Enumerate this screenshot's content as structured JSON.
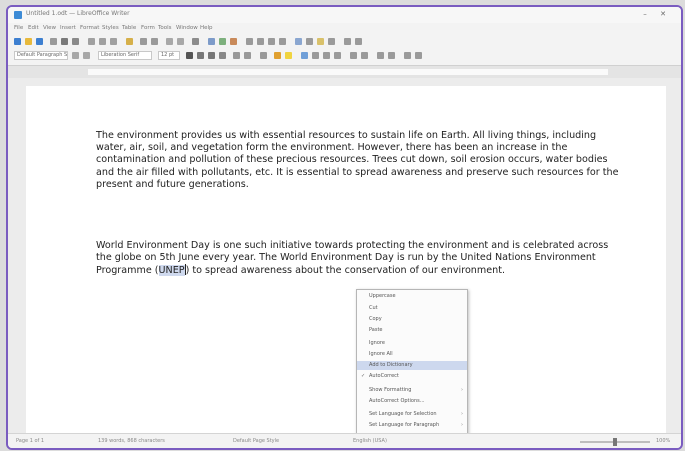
{
  "window": {
    "title": "Untitled 1.odt — LibreOffice Writer"
  },
  "menu": [
    "File",
    "Edit",
    "View",
    "Insert",
    "Format",
    "Styles",
    "Table",
    "Form",
    "Tools",
    "Window",
    "Help"
  ],
  "toolbar": {
    "paragraph_style": "Default Paragraph Style",
    "font_name": "Liberation Serif",
    "font_size": "12 pt"
  },
  "document": {
    "p1": "The environment provides us with essential resources to sustain life on Earth. All living things, including water, air, soil, and vegetation form the environment. However, there has been an increase in the contamination and pollution of these precious resources. Trees cut down, soil erosion occurs, water bodies and the air filled with pollutants, etc. It is essential to spread awareness and preserve such resources for the present and future generations.",
    "p2_before": "World Environment Day is one such initiative towards protecting the environment and is celebrated across the globe on 5th June every year. The World Environment Day is run by the United Nations Environment Programme (",
    "p2_selected": "UNEP",
    "p2_after": ") to spread awareness about the conservation of our environment."
  },
  "context_menu": {
    "items": [
      {
        "label": "Uppercase",
        "arrow": "",
        "check": ""
      },
      {
        "label": "Cut",
        "arrow": "",
        "check": ""
      },
      {
        "label": "Copy",
        "arrow": "",
        "check": ""
      },
      {
        "label": "Paste",
        "arrow": "",
        "check": ""
      },
      {
        "label": "Ignore",
        "arrow": "",
        "check": ""
      },
      {
        "label": "Ignore All",
        "arrow": "",
        "check": ""
      },
      {
        "label": "Add to Dictionary",
        "arrow": "",
        "check": ""
      },
      {
        "label": "AutoCorrect",
        "arrow": "",
        "check": "✓"
      },
      {
        "label": "Show Formatting",
        "arrow": "›",
        "check": ""
      },
      {
        "label": "AutoCorrect Options...",
        "arrow": "",
        "check": ""
      },
      {
        "label": "Set Language for Selection",
        "arrow": "›",
        "check": ""
      },
      {
        "label": "Set Language for Paragraph",
        "arrow": "›",
        "check": ""
      }
    ]
  },
  "statusbar": {
    "page": "Page 1 of 1",
    "words": "139 words, 868 characters",
    "style": "Default Page Style",
    "language": "English (USA)",
    "zoom": "100%",
    "zoom_level": 0.5
  },
  "colors": {
    "frame_border": "#7a5cc0",
    "selection": "#cfd9ee",
    "accent": "#3d8bd6"
  }
}
